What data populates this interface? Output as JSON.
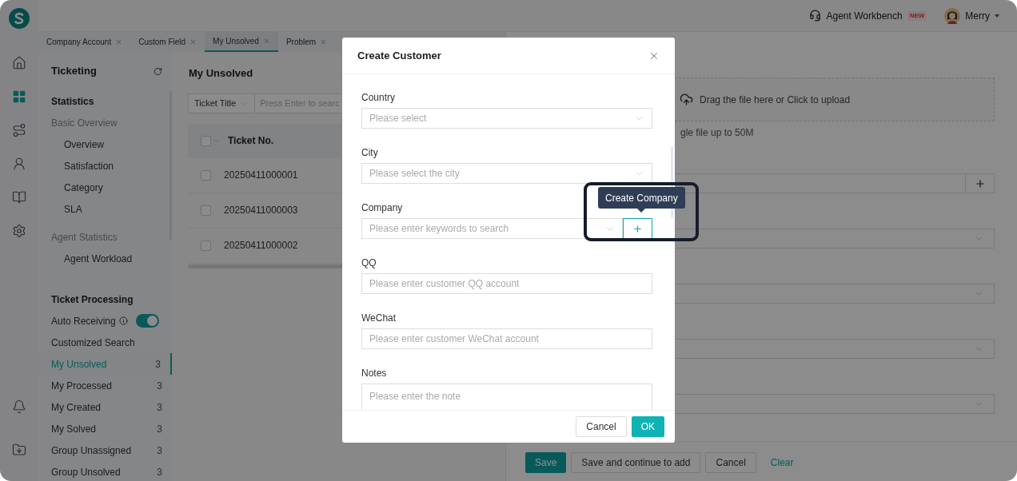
{
  "rail": {
    "items": [
      {
        "kind": "home",
        "selected": false
      },
      {
        "kind": "grid",
        "selected": true
      },
      {
        "kind": "route",
        "selected": false
      },
      {
        "kind": "user",
        "selected": false
      },
      {
        "kind": "book",
        "selected": false
      },
      {
        "kind": "settings",
        "selected": false
      }
    ],
    "bottom": [
      {
        "kind": "bell"
      },
      {
        "kind": "download"
      }
    ]
  },
  "topbar": {
    "workbench": "Agent Workbench",
    "badge": "NEW",
    "user": "Merry"
  },
  "tabs": [
    {
      "label": "Company Account",
      "selected": false
    },
    {
      "label": "Custom Field",
      "selected": false
    },
    {
      "label": "My Unsolved",
      "selected": true
    },
    {
      "label": "Problem",
      "selected": false
    }
  ],
  "sidebar": {
    "title": "Ticketing",
    "items": [
      {
        "kind": "heading",
        "label": "Statistics"
      },
      {
        "kind": "group",
        "label": "Basic Overview"
      },
      {
        "kind": "link",
        "label": "Overview"
      },
      {
        "kind": "link",
        "label": "Satisfaction"
      },
      {
        "kind": "link",
        "label": "Category"
      },
      {
        "kind": "link",
        "label": "SLA"
      },
      {
        "kind": "group",
        "label": "Agent Statistics"
      },
      {
        "kind": "link",
        "label": "Agent Workload"
      },
      {
        "kind": "heading",
        "label": "Ticket Processing"
      },
      {
        "kind": "toggle",
        "label": "Auto Receiving",
        "on": true
      },
      {
        "kind": "plain",
        "label": "Customized Search"
      },
      {
        "kind": "count",
        "label": "My Unsolved",
        "count": "3",
        "selected": true
      },
      {
        "kind": "count",
        "label": "My Processed",
        "count": "3",
        "selected": false
      },
      {
        "kind": "count",
        "label": "My Created",
        "count": "3",
        "selected": false
      },
      {
        "kind": "count",
        "label": "My Solved",
        "count": "3",
        "selected": false
      },
      {
        "kind": "count",
        "label": "Group Unassigned",
        "count": "3",
        "selected": false
      },
      {
        "kind": "count",
        "label": "Group Unsolved",
        "count": "3",
        "selected": false
      }
    ]
  },
  "list": {
    "title": "My Unsolved",
    "filter": "Ticket Title",
    "search_placeholder": "Press Enter to searc",
    "header_checked": false,
    "columns": [
      "Ticket No."
    ],
    "rows": [
      {
        "ticket_no": "20250411000001",
        "checked": false
      },
      {
        "ticket_no": "20250411000003",
        "checked": false
      },
      {
        "ticket_no": "20250411000002",
        "checked": false
      }
    ]
  },
  "form": {
    "upload": "Drag the file here or Click to upload",
    "upload_hint": "gle file up to 50M",
    "fields": [
      {
        "kind": "add"
      },
      {
        "kind": "select"
      },
      {
        "kind": "select"
      },
      {
        "kind": "select"
      },
      {
        "kind": "select"
      }
    ],
    "buttons": [
      {
        "label": "Save",
        "kind": "primary"
      },
      {
        "label": "Save and continue to add",
        "kind": "default"
      },
      {
        "label": "Cancel",
        "kind": "default"
      },
      {
        "label": "Clear",
        "kind": "link"
      }
    ]
  },
  "modal": {
    "title": "Create Customer",
    "fields": [
      {
        "label": "Country",
        "kind": "select",
        "placeholder": "Please select"
      },
      {
        "label": "City",
        "kind": "select",
        "placeholder": "Please select the city"
      },
      {
        "label": "Company",
        "kind": "company",
        "placeholder": "Please enter keywords to search"
      },
      {
        "label": "QQ",
        "kind": "input",
        "placeholder": "Please enter customer QQ account"
      },
      {
        "label": "WeChat",
        "kind": "input",
        "placeholder": "Please enter customer WeChat account"
      },
      {
        "label": "Notes",
        "kind": "textarea",
        "placeholder": "Please enter the note"
      }
    ],
    "buttons": [
      {
        "label": "Cancel",
        "kind": "default"
      },
      {
        "label": "OK",
        "kind": "primary"
      }
    ],
    "tooltip": "Create Company"
  }
}
